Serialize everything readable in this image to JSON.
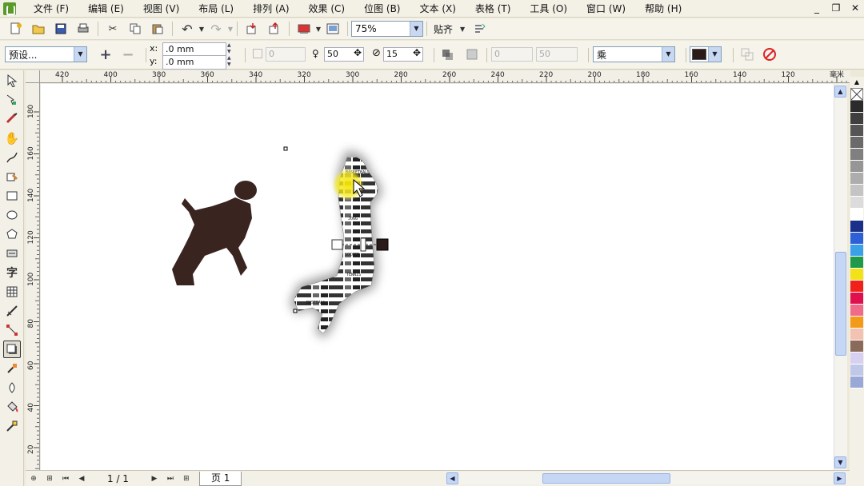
{
  "menu": [
    "文件 (F)",
    "编辑 (E)",
    "视图 (V)",
    "布局 (L)",
    "排列 (A)",
    "效果 (C)",
    "位图 (B)",
    "文本 (X)",
    "表格 (T)",
    "工具 (O)",
    "窗口 (W)",
    "帮助 (H)"
  ],
  "window_controls": [
    "_",
    "❐",
    "✕"
  ],
  "toolbar": {
    "zoom": "75%",
    "snap_label": "贴齐"
  },
  "property_bar": {
    "preset": "预设...",
    "x_label": "x:",
    "x_value": ".0 mm",
    "y_label": "y:",
    "y_value": ".0 mm",
    "shadow_offset": "0",
    "opacity": "50",
    "feather": "15",
    "angle": "0",
    "stretch": "50",
    "merge_mode": "乘",
    "shadow_color": "#2a1a18"
  },
  "ruler_h_ticks": [
    "420",
    "400",
    "380",
    "360",
    "340",
    "320",
    "300",
    "280",
    "260",
    "240",
    "220",
    "200",
    "180",
    "160",
    "140",
    "120",
    "毫米"
  ],
  "ruler_v_ticks": [
    "180",
    "160",
    "140",
    "120",
    "100",
    "80",
    "60",
    "40",
    "20"
  ],
  "status": {
    "page_count": "1 / 1",
    "page_tab": "页 1"
  },
  "canvas": {
    "text_art_words": [
      "BASKETBALL",
      "JOGG",
      "SOCCER",
      "TENNIS",
      "BASEBALL"
    ]
  },
  "palette_colors": [
    "#2b2b2b",
    "#3f3f3f",
    "#555555",
    "#6a6a6a",
    "#808080",
    "#969696",
    "#adadad",
    "#c4c4c4",
    "#dcdcdc",
    "#ffffff",
    "#1a2f8a",
    "#2d5fd6",
    "#3aa0e8",
    "#1f9a4a",
    "#f2e21a",
    "#f0201a",
    "#e0104f",
    "#f06a8a",
    "#f39a1a",
    "#f4c2b0",
    "#8a6a5a",
    "#d8d0f0",
    "#c0c8e8",
    "#9aa8d8"
  ]
}
